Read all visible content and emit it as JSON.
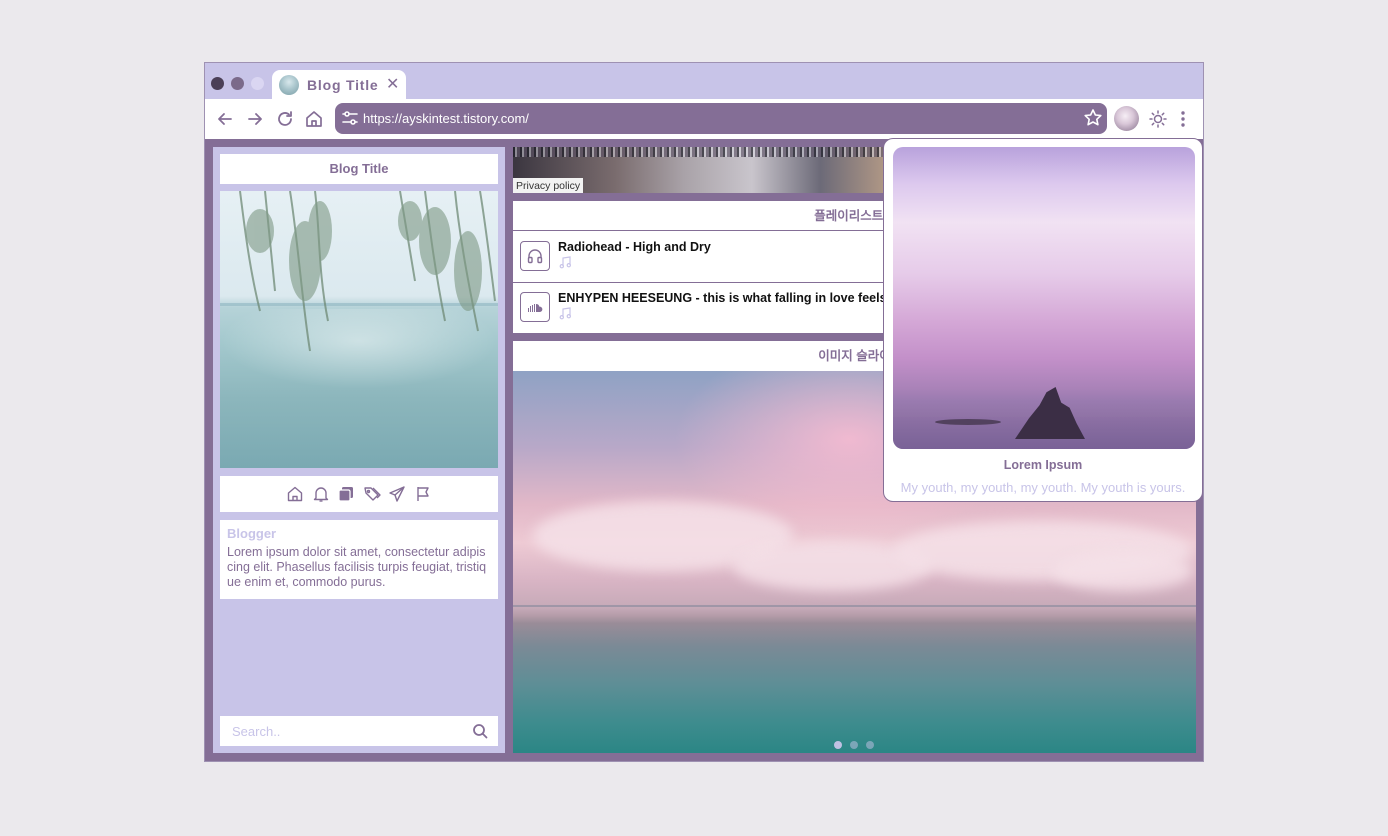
{
  "browser": {
    "tab_title": "Blog Title",
    "tab_close": "✕",
    "url": "https://ayskintest.tistory.com/"
  },
  "sidebar": {
    "title": "Blog Title",
    "icons": [
      "home-icon",
      "bell-icon",
      "copy-icon",
      "tags-icon",
      "send-icon",
      "flag-icon"
    ],
    "blogger_name": "Blogger",
    "blogger_desc": "Lorem ipsum dolor sit amet, consectetur adipiscing elit. Phasellus facilisis turpis feugiat, tristique enim et, commodo purus.",
    "search_placeholder": "Search.."
  },
  "video": {
    "privacy": "Privacy policy"
  },
  "playlist": {
    "heading": "플레이리스트형",
    "items": [
      {
        "title": "Radiohead - High and Dry",
        "icon": "headphones-icon"
      },
      {
        "title": "ENHYPEN HEESEUNG - this is what falling in love feels",
        "icon": "soundcloud-icon"
      }
    ]
  },
  "slider": {
    "heading": "이미지 슬라이",
    "dot_count": 3,
    "active_dot": 0
  },
  "popup": {
    "title": "Lorem Ipsum",
    "subtitle": "My youth, my youth, my youth. My youth is yours."
  },
  "colors": {
    "primary": "#846e96",
    "secondary": "#c8c4e8",
    "background": "#ebe9ed"
  }
}
